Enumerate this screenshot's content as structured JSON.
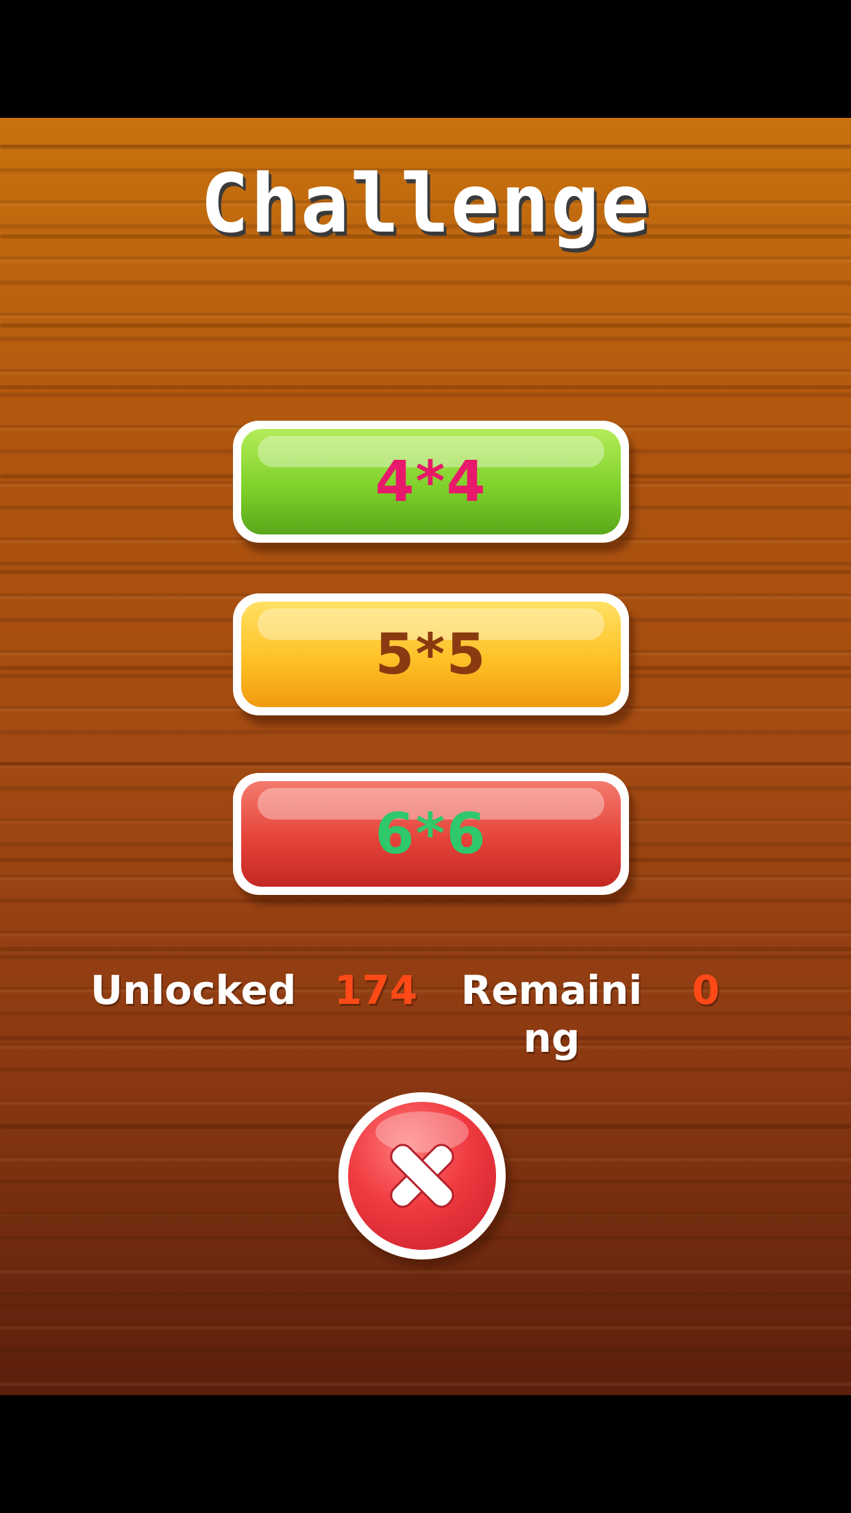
{
  "screen": {
    "title": "Challenge"
  },
  "modes": [
    {
      "label": "4*4",
      "color": "#7fd12a",
      "text_color": "#e8196a"
    },
    {
      "label": "5*5",
      "color": "#ffc126",
      "text_color": "#8a3a10"
    },
    {
      "label": "6*6",
      "color": "#e5433a",
      "text_color": "#2fc86a"
    }
  ],
  "status": {
    "unlocked_label": "Unlocked",
    "unlocked_count": "174",
    "remaining_label": "Remaining",
    "remaining_count": "0"
  },
  "close_button": {
    "icon": "close-icon",
    "color": "#e5433a"
  }
}
